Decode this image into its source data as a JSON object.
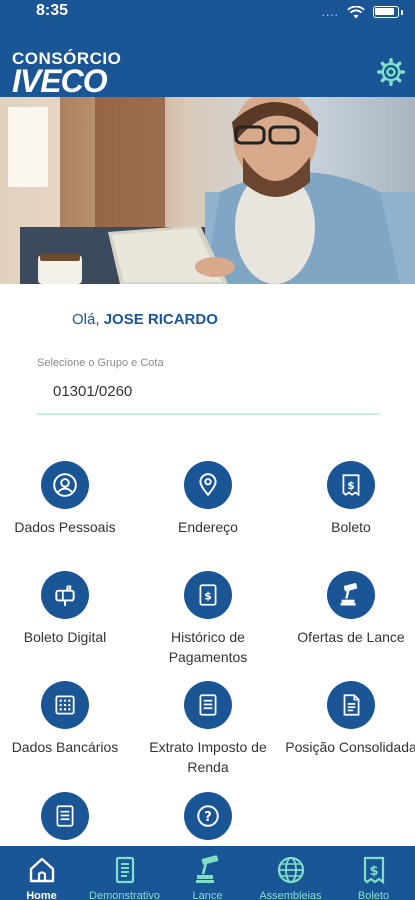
{
  "status_bar": {
    "time": "8:35",
    "signal": "....",
    "icons": [
      "wifi-icon",
      "battery-icon"
    ]
  },
  "header": {
    "logo_top": "CONSÓRCIO",
    "logo_bottom": "IVECO",
    "settings_icon": "gear-icon"
  },
  "hero": {
    "description": "man-with-tablet-photo"
  },
  "greeting": {
    "prefix": "Olá,",
    "name": "JOSE RICARDO"
  },
  "group_select": {
    "label": "Selecione o Grupo e Cota",
    "value": "01301/0260"
  },
  "menu": [
    {
      "label": "Dados Pessoais",
      "icon": "user-circle-icon"
    },
    {
      "label": "Endereço",
      "icon": "map-pin-icon"
    },
    {
      "label": "Boleto",
      "icon": "dollar-bill-icon"
    },
    {
      "label": "Boleto Digital",
      "icon": "mailbox-icon"
    },
    {
      "label": "Histórico de Pagamentos",
      "icon": "receipt-dollar-icon"
    },
    {
      "label": "Ofertas de Lance",
      "icon": "gavel-icon"
    },
    {
      "label": "Dados Bancários",
      "icon": "bank-statement-icon"
    },
    {
      "label": "Extrato Imposto de Renda",
      "icon": "document-list-icon"
    },
    {
      "label": "Posição Consolidada",
      "icon": "document-chart-icon"
    },
    {
      "label": "",
      "icon": "document-icon"
    },
    {
      "label": "",
      "icon": "help-circle-icon"
    }
  ],
  "bottom_nav": [
    {
      "label": "Home",
      "icon": "home-icon",
      "active": true
    },
    {
      "label": "Demonstrativo",
      "icon": "statement-icon",
      "active": false
    },
    {
      "label": "Lance",
      "icon": "gavel-icon",
      "active": false
    },
    {
      "label": "Assembleias",
      "icon": "globe-icon",
      "active": false
    },
    {
      "label": "Boleto",
      "icon": "dollar-bill-icon",
      "active": false
    }
  ],
  "colors": {
    "primary": "#1a5596",
    "accent": "#7fe0c8",
    "text": "#333333"
  }
}
